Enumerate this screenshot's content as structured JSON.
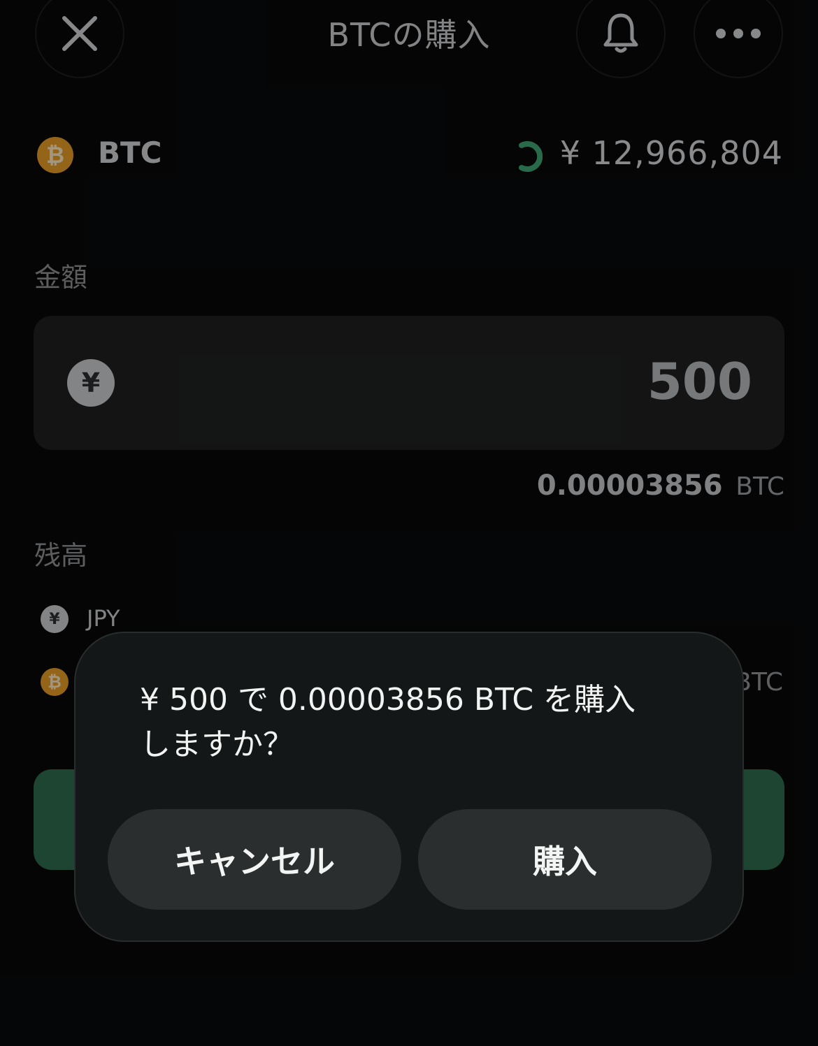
{
  "header": {
    "title": "BTCの購入",
    "close_icon": "close-icon",
    "bell_icon": "bell-icon",
    "more_icon": "more-icon"
  },
  "asset": {
    "symbol": "BTC",
    "price": "¥ 12,966,804",
    "loading_icon": "spinner-icon",
    "accent_color": "#3fa472"
  },
  "amount": {
    "label": "金額",
    "value": "500",
    "currency_symbol": "¥",
    "converted_value": "0.00003856",
    "converted_unit": "BTC"
  },
  "balance": {
    "label": "残高",
    "items": [
      {
        "currency": "JPY",
        "icon": "yen-coin-icon"
      },
      {
        "unit": "BTC",
        "icon": "bitcoin-coin-icon"
      }
    ]
  },
  "dialog": {
    "message_line1": "¥ 500 で 0.00003856 BTC を購入",
    "message_line2": "しますか？",
    "cancel_label": "キャンセル",
    "confirm_label": "購入"
  }
}
